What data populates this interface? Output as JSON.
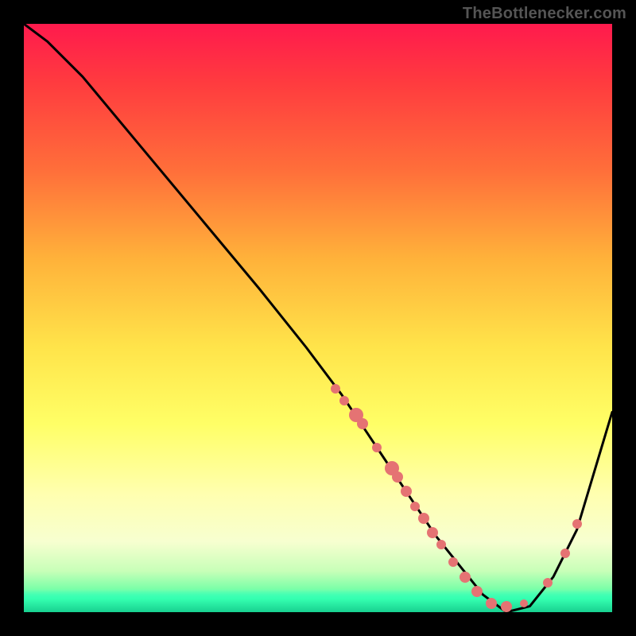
{
  "watermark": "TheBottlenecker.com",
  "chart_data": {
    "type": "line",
    "title": "",
    "xlabel": "",
    "ylabel": "",
    "xlim": [
      0,
      100
    ],
    "ylim": [
      0,
      100
    ],
    "background": "gradient red-to-green vertical",
    "series": [
      {
        "name": "curve",
        "x": [
          0,
          4,
          10,
          20,
          30,
          40,
          48,
          54,
          58,
          62,
          66,
          70,
          74,
          78,
          82,
          86,
          90,
          94,
          100
        ],
        "y": [
          100,
          97,
          91,
          79,
          67,
          55,
          45,
          37,
          31,
          25,
          19,
          13,
          8,
          3,
          0,
          1,
          6,
          14,
          34
        ]
      }
    ],
    "markers": [
      {
        "x": 53.0,
        "y": 38.0,
        "r": 6
      },
      {
        "x": 54.5,
        "y": 36.0,
        "r": 6
      },
      {
        "x": 56.5,
        "y": 33.5,
        "r": 9
      },
      {
        "x": 57.5,
        "y": 32.0,
        "r": 7
      },
      {
        "x": 60.0,
        "y": 28.0,
        "r": 6
      },
      {
        "x": 62.5,
        "y": 24.5,
        "r": 9
      },
      {
        "x": 63.5,
        "y": 23.0,
        "r": 7
      },
      {
        "x": 65.0,
        "y": 20.5,
        "r": 7
      },
      {
        "x": 66.5,
        "y": 18.0,
        "r": 6
      },
      {
        "x": 68.0,
        "y": 16.0,
        "r": 7
      },
      {
        "x": 69.5,
        "y": 13.5,
        "r": 7
      },
      {
        "x": 71.0,
        "y": 11.5,
        "r": 6
      },
      {
        "x": 73.0,
        "y": 8.5,
        "r": 6
      },
      {
        "x": 75.0,
        "y": 6.0,
        "r": 7
      },
      {
        "x": 77.0,
        "y": 3.5,
        "r": 7
      },
      {
        "x": 79.5,
        "y": 1.5,
        "r": 7
      },
      {
        "x": 82.0,
        "y": 1.0,
        "r": 7
      },
      {
        "x": 85.0,
        "y": 1.5,
        "r": 5
      },
      {
        "x": 89.0,
        "y": 5.0,
        "r": 6
      },
      {
        "x": 92.0,
        "y": 10.0,
        "r": 6
      },
      {
        "x": 94.0,
        "y": 15.0,
        "r": 6
      }
    ]
  }
}
